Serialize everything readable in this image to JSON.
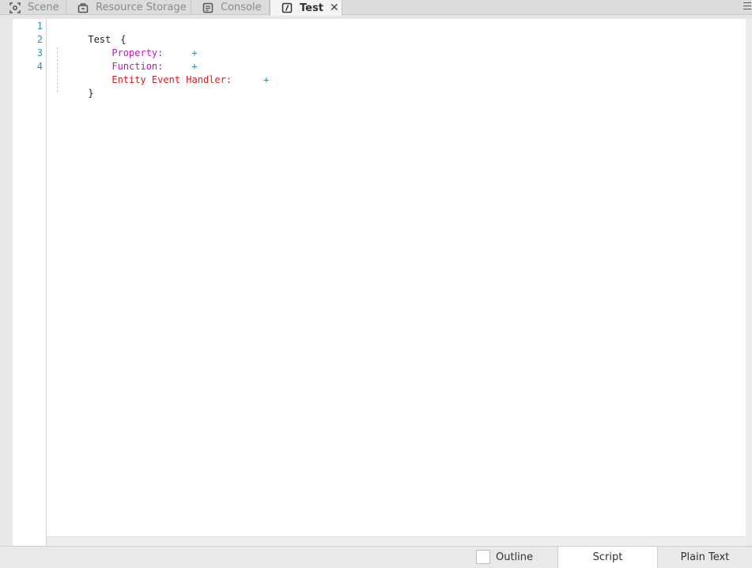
{
  "tabs": [
    {
      "label": "Scene",
      "icon": "scene-icon"
    },
    {
      "label": "Resource Storage",
      "icon": "storage-icon"
    },
    {
      "label": "Console",
      "icon": "console-icon"
    },
    {
      "label": "Test",
      "icon": "script-icon",
      "active": true
    }
  ],
  "tab_close": "✕",
  "editor": {
    "line_numbers": [
      "1",
      "2",
      "3",
      "4"
    ],
    "lines": {
      "l1_name": "Test",
      "l1_brace": "{",
      "l2_key": "Property:",
      "l3_key": "Function:",
      "l4_key": "Entity Event Handler:",
      "plus": "+",
      "close_brace": "}"
    }
  },
  "bottom": {
    "outline_label": "Outline",
    "script_tab": "Script",
    "plain_text_tab": "Plain Text"
  },
  "colors": {
    "property": "#c015c0",
    "event": "#d01f1f",
    "plus": "#1a8fc4",
    "line_number": "#2a8fb8"
  }
}
